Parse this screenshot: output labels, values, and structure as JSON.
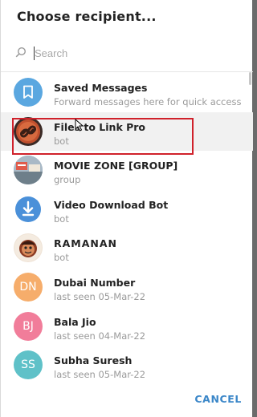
{
  "dialog": {
    "title": "Choose recipient...",
    "search_placeholder": "Search",
    "cancel_label": "CANCEL"
  },
  "contacts": [
    {
      "name": "Saved Messages",
      "status": "Forward messages here for quick access",
      "avatar": "bookmark-icon",
      "color": "#5aa7e0"
    },
    {
      "name": "Files to Link Pro",
      "status": "bot",
      "avatar": "link-logo",
      "color": "#b8452a"
    },
    {
      "name": "MOVIE ZONE [GROUP]",
      "status": "group",
      "avatar": "movie-zone-photo",
      "color": "#8aa3b8"
    },
    {
      "name": "Video Download Bot",
      "status": "bot",
      "avatar": "download-icon",
      "color": "#ffffff"
    },
    {
      "name": "RAMANAN",
      "status": "bot",
      "avatar": "cartoon-photo",
      "color": "#e8c8b0"
    },
    {
      "name": "Dubai Number",
      "status": "last seen 05-Mar-22",
      "initials": "DN",
      "color": "#f6ad6b"
    },
    {
      "name": "Bala Jio",
      "status": "last seen 04-Mar-22",
      "initials": "BJ",
      "color": "#f17d9a"
    },
    {
      "name": "Subha Suresh",
      "status": "last seen 05-Mar-22",
      "initials": "SS",
      "color": "#5fc1c8"
    }
  ]
}
